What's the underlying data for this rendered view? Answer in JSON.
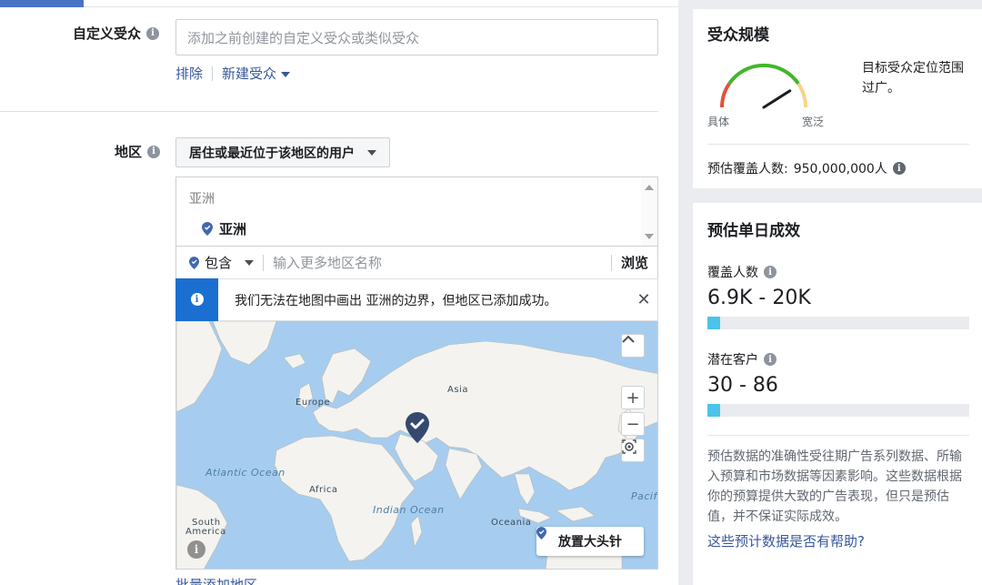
{
  "custom_audience": {
    "label": "自定义受众",
    "placeholder": "添加之前创建的自定义受众或类似受众",
    "exclude_link": "排除",
    "create_new_link": "新建受众"
  },
  "location": {
    "label": "地区",
    "dropdown_value": "居住或最近位于该地区的用户",
    "region_header": "亚洲",
    "selected_item": "亚洲",
    "include_value": "包含",
    "more_placeholder": "输入更多地区名称",
    "browse_label": "浏览",
    "notice_text": "我们无法在地图中画出 亚洲的边界，但地区已添加成功。",
    "map_labels": {
      "asia": "Asia",
      "europe": "Europe",
      "africa": "Africa",
      "oceania": "Oceania",
      "atlantic": "Atlantic Ocean",
      "indian": "Indian Ocean",
      "pacific": "Pacifi",
      "south_america_1": "South",
      "south_america_2": "America"
    },
    "map_controls": {
      "zoom_in": "+",
      "zoom_out": "−"
    },
    "drop_pin_label": "放置大头针",
    "bulk_add": "批量添加地区"
  },
  "audience_size": {
    "title": "受众规模",
    "specific_label": "具体",
    "broad_label": "宽泛",
    "description": "目标受众定位范围过广。",
    "reach_label": "预估覆盖人数:",
    "reach_value": "950,000,000人",
    "gauge_level": 0.82
  },
  "daily_results": {
    "title": "预估单日成效",
    "reach_label": "覆盖人数",
    "reach_value": "6.9K - 20K",
    "reach_fill": 0.05,
    "leads_label": "潜在客户",
    "leads_value": "30 - 86",
    "leads_fill": 0.05,
    "disclaimer": "预估数据的准确性受往期广告系列数据、所输入预算和市场数据等因素影响。这些数据根据你的预算提供大致的广告表现，但只是预估值，并不保证实际成效。",
    "helpful_link": "这些预计数据是否有帮助?"
  },
  "colors": {
    "accent_blue": "#4a73c4",
    "link": "#365899",
    "info_blue": "#1a6fd1",
    "bar_fill": "#4cc3e8",
    "map_water": "#a6cdef",
    "gauge_red": "#e0533d",
    "gauge_green": "#42b72a",
    "gauge_yellow": "#f7d48a"
  }
}
